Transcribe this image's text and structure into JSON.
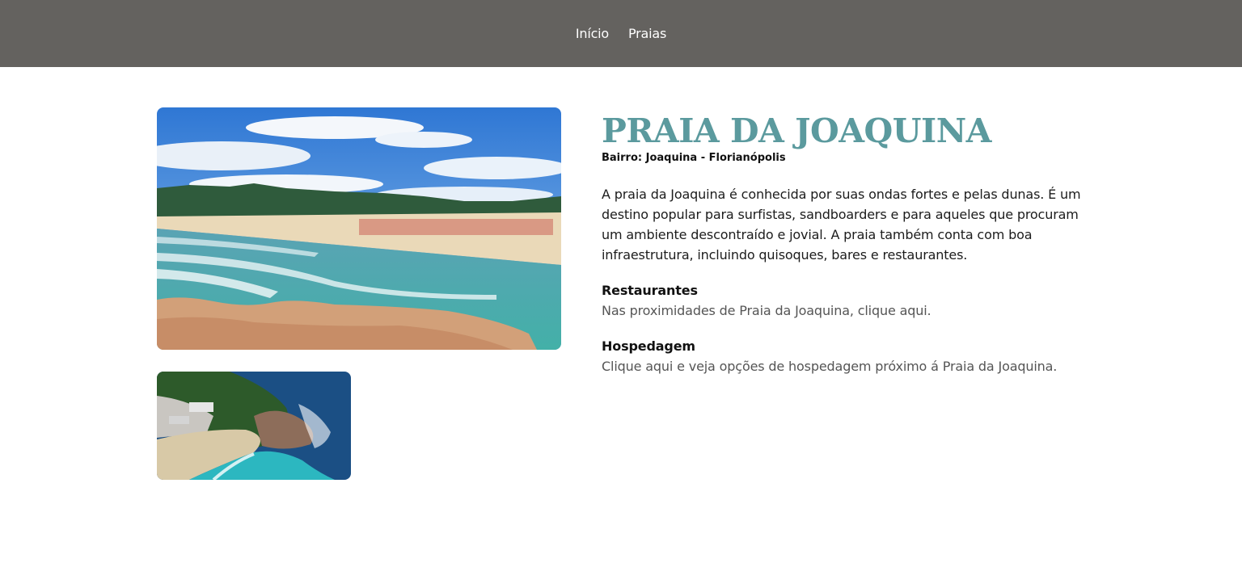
{
  "nav": {
    "items": [
      {
        "label": "Início"
      },
      {
        "label": "Praias"
      }
    ]
  },
  "beach": {
    "title": "PRAIA DA JOAQUINA",
    "subtitle": "Bairro: Joaquina - Florianópolis",
    "description": "A praia da Joaquina é conhecida por suas ondas fortes e pelas dunas. É um destino popular para surfistas, sandboarders e para aqueles que procuram um ambiente descontraído e jovial. A praia também conta com boa infraestrutura, incluindo quisoques, bares e restaurantes."
  },
  "restaurants": {
    "heading": "Restaurantes",
    "text": "Nas proximidades de Praia da Joaquina, clique aqui."
  },
  "lodging": {
    "heading": "Hospedagem",
    "text": "Clique aqui e veja opções de hospedagem próximo á Praia da Joaquina."
  },
  "colors": {
    "nav_background": "#64625f",
    "title": "#5b9a9e"
  }
}
